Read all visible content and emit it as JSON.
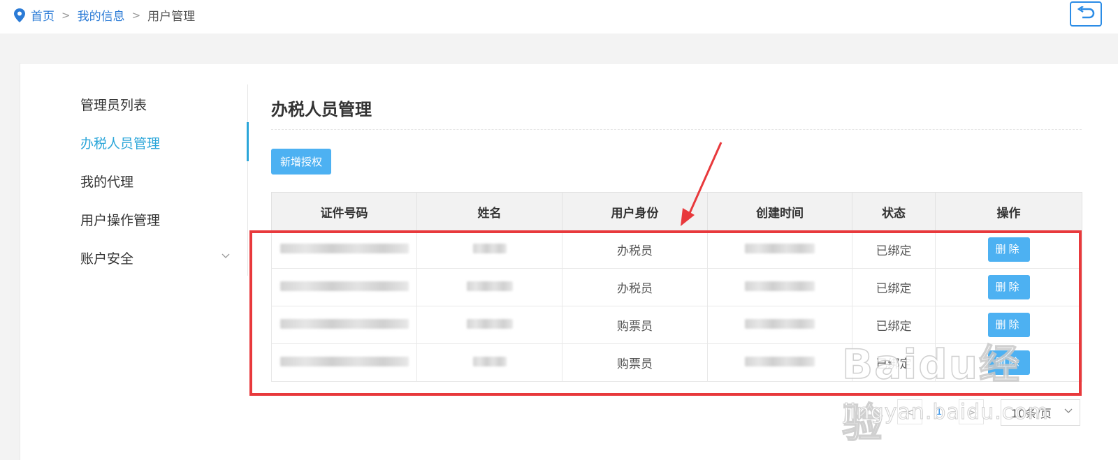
{
  "breadcrumb": {
    "home": "首页",
    "separator": ">",
    "level2": "我的信息",
    "current": "用户管理"
  },
  "side_menu": {
    "items": [
      {
        "label": "管理员列表"
      },
      {
        "label": "办税人员管理"
      },
      {
        "label": "我的代理"
      },
      {
        "label": "用户操作管理"
      },
      {
        "label": "账户安全"
      }
    ],
    "active_index": 1
  },
  "content": {
    "title": "办税人员管理",
    "add_button": "新增授权"
  },
  "table": {
    "headers": [
      "证件号码",
      "姓名",
      "用户身份",
      "创建时间",
      "状态",
      "操作"
    ],
    "rows": [
      {
        "role": "办税员",
        "status": "已绑定",
        "action": "删除"
      },
      {
        "role": "办税员",
        "status": "已绑定",
        "action": "删除"
      },
      {
        "role": "购票员",
        "status": "已绑定",
        "action": "删除"
      },
      {
        "role": "购票员",
        "status": "已绑定",
        "action": "删除"
      }
    ]
  },
  "pagination": {
    "prev": "<",
    "current_page": "1",
    "next": ">",
    "page_size": "10条/页"
  },
  "watermark": {
    "brand": "Baidu经验",
    "url": "jingyan.baidu.com"
  },
  "colors": {
    "accent": "#2ba6d9",
    "button": "#4db1f2",
    "highlight": "#e8393c",
    "link": "#2b7bd6"
  }
}
